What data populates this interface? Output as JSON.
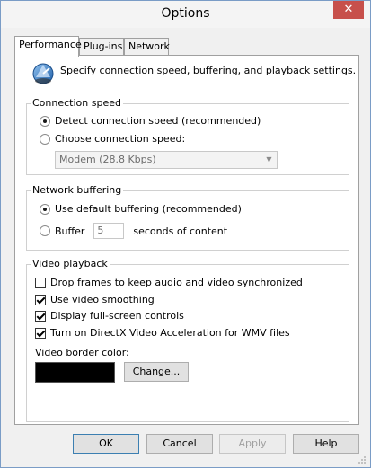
{
  "window": {
    "title": "Options",
    "close_glyph": "✕"
  },
  "tabs": [
    {
      "label": "Performance",
      "active": true
    },
    {
      "label": "Plug-ins",
      "active": false
    },
    {
      "label": "Network",
      "active": false
    }
  ],
  "intro": {
    "icon": "performance-gauge-icon",
    "text": "Specify connection speed, buffering, and playback settings."
  },
  "connection_speed": {
    "label": "Connection speed",
    "detect_label": "Detect connection speed (recommended)",
    "detect_checked": true,
    "choose_label": "Choose connection speed:",
    "choose_checked": false,
    "speed_select_value": "Modem (28.8 Kbps)"
  },
  "network_buffering": {
    "label": "Network buffering",
    "default_label": "Use default buffering (recommended)",
    "default_checked": true,
    "buffer_label": "Buffer",
    "buffer_checked": false,
    "buffer_value": "5",
    "buffer_suffix": "seconds of content"
  },
  "video_playback": {
    "label": "Video playback",
    "options": [
      {
        "label": "Drop frames to keep audio and video synchronized",
        "checked": false
      },
      {
        "label": "Use video smoothing",
        "checked": true
      },
      {
        "label": "Display full-screen controls",
        "checked": true
      },
      {
        "label": "Turn on DirectX Video Acceleration for WMV files",
        "checked": true
      }
    ],
    "border_color_label": "Video border color:",
    "border_color": "#000000",
    "change_button": "Change..."
  },
  "buttons": {
    "ok": "OK",
    "cancel": "Cancel",
    "apply": "Apply",
    "help": "Help"
  }
}
